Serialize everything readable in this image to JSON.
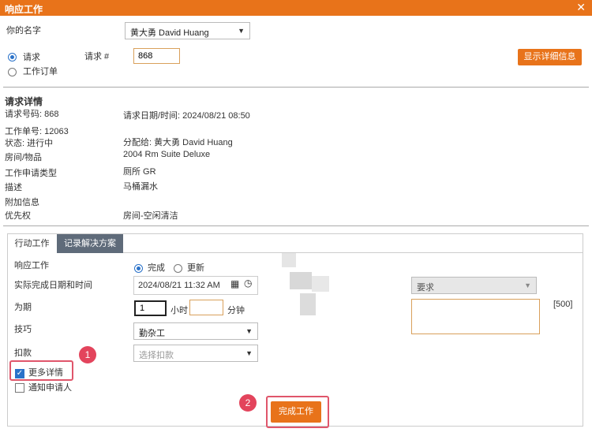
{
  "dialog": {
    "title": "响应工作"
  },
  "top": {
    "name_label": "你的名字",
    "name_value": "黄大勇 David Huang",
    "radio_request": "请求",
    "radio_workorder": "工作订单",
    "request_no_label": "请求 #",
    "request_no_value": "868",
    "show_details_button": "显示详细信息"
  },
  "details": {
    "heading": "请求详情",
    "request_no": "请求号码: 868",
    "request_datetime": "请求日期/时间: 2024/08/21 08:50",
    "work_no": "工作单号: 12063",
    "status": "状态: 进行中",
    "assigned_to": "分配给: 黄大勇 David Huang",
    "room_label": "房间/物品",
    "room_value": "2004 Rm Suite Deluxe",
    "type_label": "工作申请类型",
    "type_value": "厕所 GR",
    "desc_label": "描述",
    "desc_value": "马桶漏水",
    "addinfo_label": "附加信息",
    "priority_label": "优先权",
    "priority_value": "房间-空闲清洁"
  },
  "tabs": {
    "action": "行动工作",
    "record": "记录解决方案"
  },
  "form": {
    "response_label": "响应工作",
    "opt_complete": "完成",
    "opt_update": "更新",
    "actual_dt_label": "实际完成日期和时间",
    "actual_dt_value": "2024/08/21 11:32 AM",
    "duration_label": "为期",
    "hours_value": "1",
    "hours_unit": "小时",
    "minutes_unit": "分钟",
    "skill_label": "技巧",
    "skill_value": "勤杂工",
    "deduct_label": "扣款",
    "deduct_placeholder": "选择扣款",
    "more_details": "更多详情",
    "notify_requester": "通知申请人",
    "request_select": "要求",
    "char_limit": "[500]",
    "complete_button": "完成工作"
  },
  "markers": {
    "m1": "1",
    "m2": "2"
  }
}
